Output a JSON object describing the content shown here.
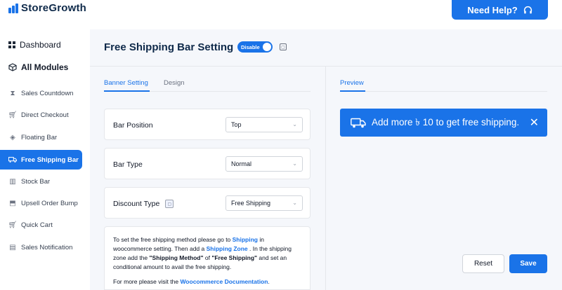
{
  "header": {
    "brand": "StoreGrowth",
    "help_label": "Need Help?",
    "help_icon": "headset-icon"
  },
  "sidebar": {
    "dashboard": "Dashboard",
    "all_modules": "All Modules",
    "items": [
      {
        "label": "Sales Countdown",
        "icon": "hourglass-icon"
      },
      {
        "label": "Direct Checkout",
        "icon": "cart-icon"
      },
      {
        "label": "Floating Bar",
        "icon": "tag-icon"
      },
      {
        "label": "Free Shipping Bar",
        "icon": "truck-icon",
        "active": true
      },
      {
        "label": "Stock Bar",
        "icon": "bar-chart-icon"
      },
      {
        "label": "Upsell Order Bump",
        "icon": "upsell-icon"
      },
      {
        "label": "Quick Cart",
        "icon": "cart-icon"
      },
      {
        "label": "Sales Notification",
        "icon": "notification-icon"
      }
    ]
  },
  "main": {
    "title": "Free Shipping Bar Setting",
    "toggle_label": "Disable",
    "tabs": [
      "Banner Setting",
      "Design"
    ],
    "preview_tab": "Preview",
    "fields": [
      {
        "label": "Bar Position",
        "value": "Top"
      },
      {
        "label": "Bar Type",
        "value": "Normal"
      },
      {
        "label": "Discount Type",
        "value": "Free Shipping"
      }
    ],
    "note": {
      "p1_a": "To set the free shipping method please go to ",
      "p1_link1": "Shipping",
      "p1_b": " in woocommerce setting. Then add a ",
      "p1_link2": "Shipping Zone",
      "p1_c": " . In the shipping zone add the ",
      "p1_b1": "\"Shipping Method\"",
      "p1_d": " of ",
      "p1_b2": "\"Free Shipping\"",
      "p1_e": " and set an conditional amount to avail the free shipping.",
      "p2_a": "For more please visit the ",
      "p2_link": "Woocommerce Documentation",
      "p2_b": "."
    },
    "banner_text": "Add more ৳ 10 to get free shipping.",
    "reset_label": "Reset",
    "save_label": "Save"
  },
  "colors": {
    "accent": "#1a73e8",
    "title": "#0f2a4a",
    "background": "#f5f7fb"
  }
}
